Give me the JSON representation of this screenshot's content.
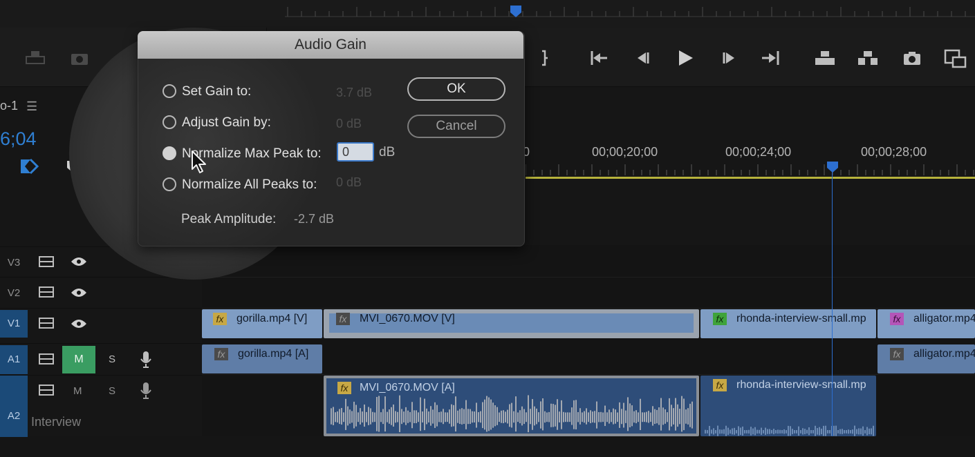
{
  "sequence": {
    "name": "o-1",
    "menu_icon": "☰",
    "timecode": "6;04"
  },
  "ruler": {
    "times": [
      "0",
      "00;00;20;00",
      "00;00;24;00",
      "00;00;28;00"
    ]
  },
  "dialog": {
    "title": "Audio Gain",
    "options": [
      {
        "label": "Set Gain to:",
        "value": "3.7 dB",
        "checked": false
      },
      {
        "label": "Adjust Gain by:",
        "value": "0 dB",
        "checked": false
      },
      {
        "label": "Normalize Max Peak to:",
        "value": "0",
        "unit": "dB",
        "checked": true
      },
      {
        "label": "Normalize All Peaks to:",
        "value": "0 dB",
        "checked": false
      }
    ],
    "ok_label": "OK",
    "cancel_label": "Cancel",
    "peak_amplitude_label": "Peak Amplitude:",
    "peak_amplitude_value": "-2.7 dB"
  },
  "tracks": [
    {
      "label": "V3",
      "active": false
    },
    {
      "label": "V2",
      "active": false
    },
    {
      "label": "V1",
      "active": true
    },
    {
      "label": "A1",
      "active": true,
      "mute": "M",
      "solo": "S",
      "mute_on": true
    },
    {
      "label": "A2",
      "active": true,
      "mute": "M",
      "solo": "S",
      "mute_on": false,
      "name": "Interview"
    }
  ],
  "clips": {
    "v1": [
      {
        "name": "gorilla.mp4 [V]",
        "fx_color": "#c7a845"
      },
      {
        "name": "MVI_0670.MOV [V]",
        "fx_color": "#4a4a4a"
      },
      {
        "name": "rhonda-interview-small.mp",
        "fx_color": "#3fa33a"
      },
      {
        "name": "alligator.mp4",
        "fx_color": "#b455b8"
      }
    ],
    "a1": [
      {
        "name": "gorilla.mp4 [A]",
        "fx_color": "#4a4a4a"
      },
      {
        "name": "alligator.mp4",
        "fx_color": "#4a4a4a"
      }
    ],
    "a2": [
      {
        "name": "MVI_0670.MOV [A]",
        "fx_color": "#c7a845"
      },
      {
        "name": "rhonda-interview-small.mp",
        "fx_color": "#c7a845"
      }
    ]
  },
  "fx_glyph": "fx",
  "colors": {
    "timecode": "#2f7fd2",
    "playhead": "#2d6fd0",
    "mute_on": "#3a9d62",
    "video_clip": "#7f9dc4",
    "audio_clip": "#2e4d79"
  }
}
